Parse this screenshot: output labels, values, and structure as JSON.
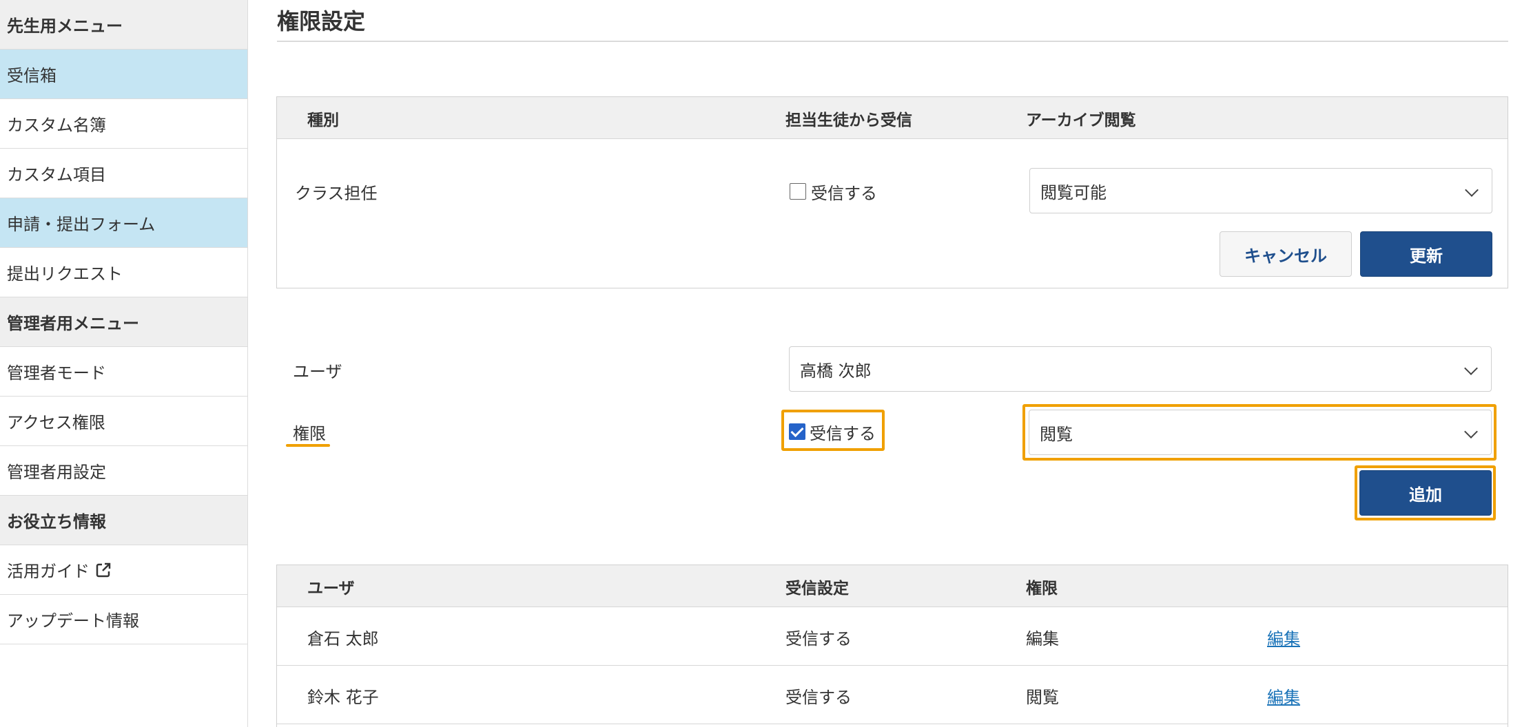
{
  "sidebar": {
    "items": [
      {
        "label": "先生用メニュー",
        "type": "header"
      },
      {
        "label": "受信箱",
        "type": "active"
      },
      {
        "label": "カスタム名簿",
        "type": "item"
      },
      {
        "label": "カスタム項目",
        "type": "item"
      },
      {
        "label": "申請・提出フォーム",
        "type": "active"
      },
      {
        "label": "提出リクエスト",
        "type": "item"
      },
      {
        "label": "管理者用メニュー",
        "type": "header"
      },
      {
        "label": "管理者モード",
        "type": "item"
      },
      {
        "label": "アクセス権限",
        "type": "item"
      },
      {
        "label": "管理者用設定",
        "type": "item"
      },
      {
        "label": "お役立ち情報",
        "type": "header"
      },
      {
        "label": "活用ガイド",
        "type": "item",
        "icon": "external-link-icon"
      },
      {
        "label": "アップデート情報",
        "type": "item"
      }
    ]
  },
  "page": {
    "title": "権限設定"
  },
  "class_panel": {
    "headers": {
      "type": "種別",
      "receive": "担当生徒から受信",
      "archive": "アーカイブ閲覧"
    },
    "row_label": "クラス担任",
    "receive_checkbox_label": "受信する",
    "receive_checked": false,
    "archive_select_value": "閲覧可能",
    "cancel_label": "キャンセル",
    "update_label": "更新"
  },
  "add_form": {
    "user_label": "ユーザ",
    "user_select_value": "高橋 次郎",
    "permission_label": "権限",
    "receive_checkbox_label": "受信する",
    "receive_checked": true,
    "permission_select_value": "閲覧",
    "add_label": "追加"
  },
  "user_table": {
    "headers": {
      "user": "ユーザ",
      "receive": "受信設定",
      "permission": "権限"
    },
    "rows": [
      {
        "user": "倉石 太郎",
        "receive": "受信する",
        "permission": "編集",
        "action": "編集"
      },
      {
        "user": "鈴木 花子",
        "receive": "受信する",
        "permission": "閲覧",
        "action": "編集"
      }
    ]
  },
  "colors": {
    "accent": "#1f4f8d",
    "highlight": "#f0a000",
    "active_menu": "#c5e5f3",
    "link": "#1a73b8"
  }
}
